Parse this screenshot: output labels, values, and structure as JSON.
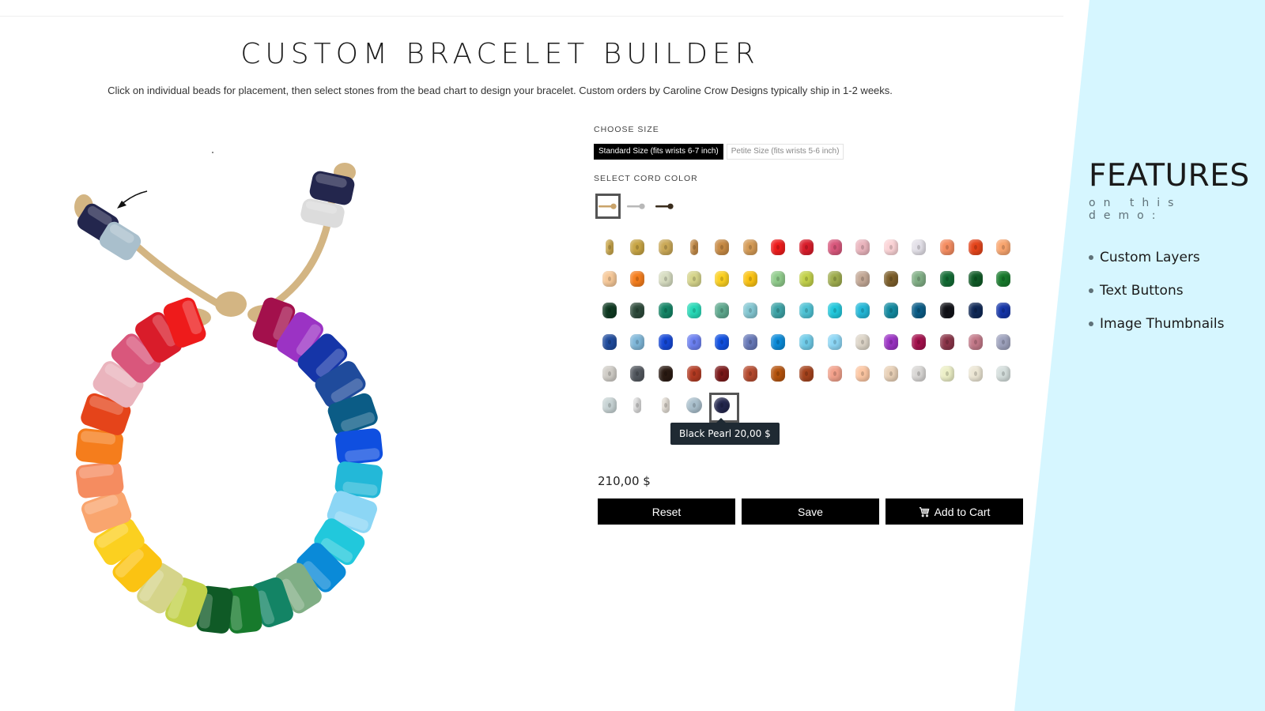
{
  "page": {
    "title": "CUSTOM BRACELET BUILDER",
    "intro": "Click on individual beads for placement, then select stones from the bead chart to design your bracelet. Custom orders by Caroline Crow Designs typically ship in 1-2 weeks."
  },
  "size": {
    "label": "CHOOSE SIZE",
    "options": [
      {
        "label": "Standard Size (fits wrists 6-7 inch)",
        "selected": true
      },
      {
        "label": "Petite Size (fits wrists 5-6 inch)",
        "selected": false
      }
    ]
  },
  "cord": {
    "label": "SELECT CORD COLOR",
    "options": [
      {
        "name": "tan",
        "color": "#c9a36a",
        "selected": true
      },
      {
        "name": "silver",
        "color": "#b8b8b8",
        "selected": false
      },
      {
        "name": "brown",
        "color": "#3a2c1c",
        "selected": false
      }
    ]
  },
  "beads": [
    {
      "color": "#c9a64a",
      "shape": "spacer"
    },
    {
      "color": "#c7a443",
      "shape": "normal"
    },
    {
      "color": "#caa856",
      "shape": "normal"
    },
    {
      "color": "#c48a45",
      "shape": "spacer"
    },
    {
      "color": "#c78a44",
      "shape": "normal"
    },
    {
      "color": "#d49a55",
      "shape": "normal"
    },
    {
      "color": "#ee1b1b",
      "shape": "normal"
    },
    {
      "color": "#d91c2a",
      "shape": "normal"
    },
    {
      "color": "#d9577c",
      "shape": "normal"
    },
    {
      "color": "#eab4bd",
      "shape": "normal"
    },
    {
      "color": "#fbd3d6",
      "shape": "normal"
    },
    {
      "color": "#e3e0e8",
      "shape": "normal"
    },
    {
      "color": "#f58c60",
      "shape": "normal"
    },
    {
      "color": "#e5441a",
      "shape": "normal"
    },
    {
      "color": "#f9a56e",
      "shape": "normal"
    },
    {
      "color": "#f6c898",
      "shape": "normal"
    },
    {
      "color": "#f57d1c",
      "shape": "normal"
    },
    {
      "color": "#d6dcc0",
      "shape": "normal"
    },
    {
      "color": "#d5d48a",
      "shape": "normal"
    },
    {
      "color": "#fbd020",
      "shape": "normal"
    },
    {
      "color": "#fbc312",
      "shape": "normal"
    },
    {
      "color": "#8fcb8b",
      "shape": "normal"
    },
    {
      "color": "#c2d14a",
      "shape": "normal"
    },
    {
      "color": "#9fad4e",
      "shape": "normal"
    },
    {
      "color": "#c3a896",
      "shape": "normal"
    },
    {
      "color": "#7c5e2a",
      "shape": "normal"
    },
    {
      "color": "#80ae85",
      "shape": "normal"
    },
    {
      "color": "#126b34",
      "shape": "normal"
    },
    {
      "color": "#0f5a26",
      "shape": "normal"
    },
    {
      "color": "#177a2c",
      "shape": "normal"
    },
    {
      "color": "#0f3a22",
      "shape": "normal"
    },
    {
      "color": "#2d4a3a",
      "shape": "normal"
    },
    {
      "color": "#138465",
      "shape": "normal"
    },
    {
      "color": "#27d9b7",
      "shape": "normal"
    },
    {
      "color": "#5fa98e",
      "shape": "normal"
    },
    {
      "color": "#84c7d2",
      "shape": "normal"
    },
    {
      "color": "#3da3a6",
      "shape": "normal"
    },
    {
      "color": "#4ec2d4",
      "shape": "normal"
    },
    {
      "color": "#21c8dc",
      "shape": "normal"
    },
    {
      "color": "#23b8d8",
      "shape": "normal"
    },
    {
      "color": "#138aa0",
      "shape": "normal"
    },
    {
      "color": "#0b5c86",
      "shape": "normal"
    },
    {
      "color": "#111218",
      "shape": "normal"
    },
    {
      "color": "#0e2755",
      "shape": "normal"
    },
    {
      "color": "#1535a8",
      "shape": "normal"
    },
    {
      "color": "#1f4b9c",
      "shape": "normal"
    },
    {
      "color": "#7eb6d8",
      "shape": "normal"
    },
    {
      "color": "#1447d6",
      "shape": "normal"
    },
    {
      "color": "#6b7ff0",
      "shape": "normal"
    },
    {
      "color": "#0f4fe0",
      "shape": "normal"
    },
    {
      "color": "#6879b8",
      "shape": "normal"
    },
    {
      "color": "#0a8ad8",
      "shape": "normal"
    },
    {
      "color": "#6fcbe8",
      "shape": "normal"
    },
    {
      "color": "#8cd6f5",
      "shape": "normal"
    },
    {
      "color": "#ddd5c8",
      "shape": "normal"
    },
    {
      "color": "#9b33c4",
      "shape": "normal"
    },
    {
      "color": "#a3104c",
      "shape": "normal"
    },
    {
      "color": "#8a3448",
      "shape": "normal"
    },
    {
      "color": "#c27888",
      "shape": "normal"
    },
    {
      "color": "#9ea2bd",
      "shape": "normal"
    },
    {
      "color": "#cfccc6",
      "shape": "normal"
    },
    {
      "color": "#52575e",
      "shape": "normal"
    },
    {
      "color": "#2a1a12",
      "shape": "normal"
    },
    {
      "color": "#b23a22",
      "shape": "normal"
    },
    {
      "color": "#7a1718",
      "shape": "normal"
    },
    {
      "color": "#b54a2e",
      "shape": "normal"
    },
    {
      "color": "#b4520c",
      "shape": "normal"
    },
    {
      "color": "#a4421c",
      "shape": "normal"
    },
    {
      "color": "#f2a08a",
      "shape": "normal"
    },
    {
      "color": "#fcc6a2",
      "shape": "normal"
    },
    {
      "color": "#e8d0b6",
      "shape": "normal"
    },
    {
      "color": "#d8d6d4",
      "shape": "normal"
    },
    {
      "color": "#ecefc6",
      "shape": "normal"
    },
    {
      "color": "#ece6d4",
      "shape": "normal"
    },
    {
      "color": "#d4dedc",
      "shape": "normal"
    },
    {
      "color": "#c7d3d4",
      "shape": "normal"
    },
    {
      "color": "#dcdcdc",
      "shape": "spacer"
    },
    {
      "color": "#e3ddd4",
      "shape": "spacer"
    },
    {
      "color": "#a9bfcc",
      "shape": "round"
    },
    {
      "color": "#23264d",
      "shape": "round",
      "selected": true
    }
  ],
  "tooltip": {
    "name": "Black Pearl",
    "price": "20,00 $",
    "text": "Black Pearl 20,00 $"
  },
  "total_price": "210,00 $",
  "actions": {
    "reset": "Reset",
    "save": "Save",
    "add_to_cart": "Add to Cart",
    "cart_icon": "cart-icon"
  },
  "features": {
    "title": "FEATURES",
    "subtitle": "on this demo:",
    "items": [
      "Custom Layers",
      "Text Buttons",
      "Image Thumbnails"
    ],
    "panel_color": "#d6f6ff"
  },
  "bracelet": {
    "cord_color": "#d3b583",
    "end_beads_left": [
      "#23264d",
      "#a9bfcc"
    ],
    "end_beads_right": [
      "#23264d",
      "#dcdcdc"
    ],
    "ring_beads": [
      "#a3104c",
      "#9b33c4",
      "#1535a8",
      "#1f4b9c",
      "#0b5c86",
      "#0f4fe0",
      "#23b8d8",
      "#8cd6f5",
      "#21c8dc",
      "#0a8ad8",
      "#80ae85",
      "#138465",
      "#177a2c",
      "#0f5a26",
      "#c2d14a",
      "#d5d48a",
      "#fbc312",
      "#fbd020",
      "#f9a56e",
      "#f58c60",
      "#f57d1c",
      "#e5441a",
      "#eab4bd",
      "#d9577c",
      "#d91c2a",
      "#ee1b1b"
    ]
  }
}
